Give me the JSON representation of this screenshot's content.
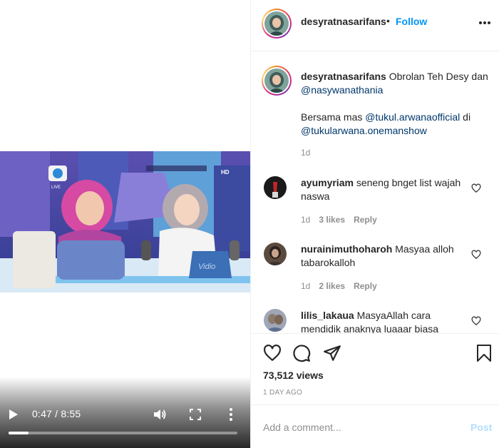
{
  "video": {
    "current_time": "0:47",
    "duration": "8:55",
    "time_display": "0:47 / 8:55",
    "progress_fraction": 0.088,
    "channel_badge": "LIVE",
    "quality_badge": "HD",
    "watermark": "Vidio"
  },
  "header": {
    "username": "desyratnasarifans",
    "separator": "•",
    "follow_label": "Follow"
  },
  "caption": {
    "username": "desyratnasarifans",
    "text_1": " Obrolan Teh Desy dan ",
    "mention_1": "@nasywanathania",
    "text_2": "Bersama mas ",
    "mention_2": "@tukul.arwanaofficial",
    "text_3": " di ",
    "mention_3": "@tukularwana.onemanshow",
    "time": "1d"
  },
  "comments": [
    {
      "username": "ayumyriam",
      "text": " seneng bnget list wajah naswa",
      "time": "1d",
      "likes": "3 likes",
      "reply_label": "Reply"
    },
    {
      "username": "nurainimuthoharoh",
      "text": " Masyaa alloh tabarokalloh",
      "time": "1d",
      "likes": "2 likes",
      "reply_label": "Reply"
    },
    {
      "username": "lilis_lakaua",
      "text": " MasyaAllah cara mendidik anaknya luaaar biasa"
    }
  ],
  "stats": {
    "views": "73,512 views",
    "date": "1 DAY AGO"
  },
  "add_comment": {
    "placeholder": "Add a comment...",
    "post_label": "Post"
  },
  "colors": {
    "accent": "#0095f6",
    "mention": "#00376b",
    "muted": "#8e8e8e",
    "post_disabled": "#b2dffc"
  }
}
